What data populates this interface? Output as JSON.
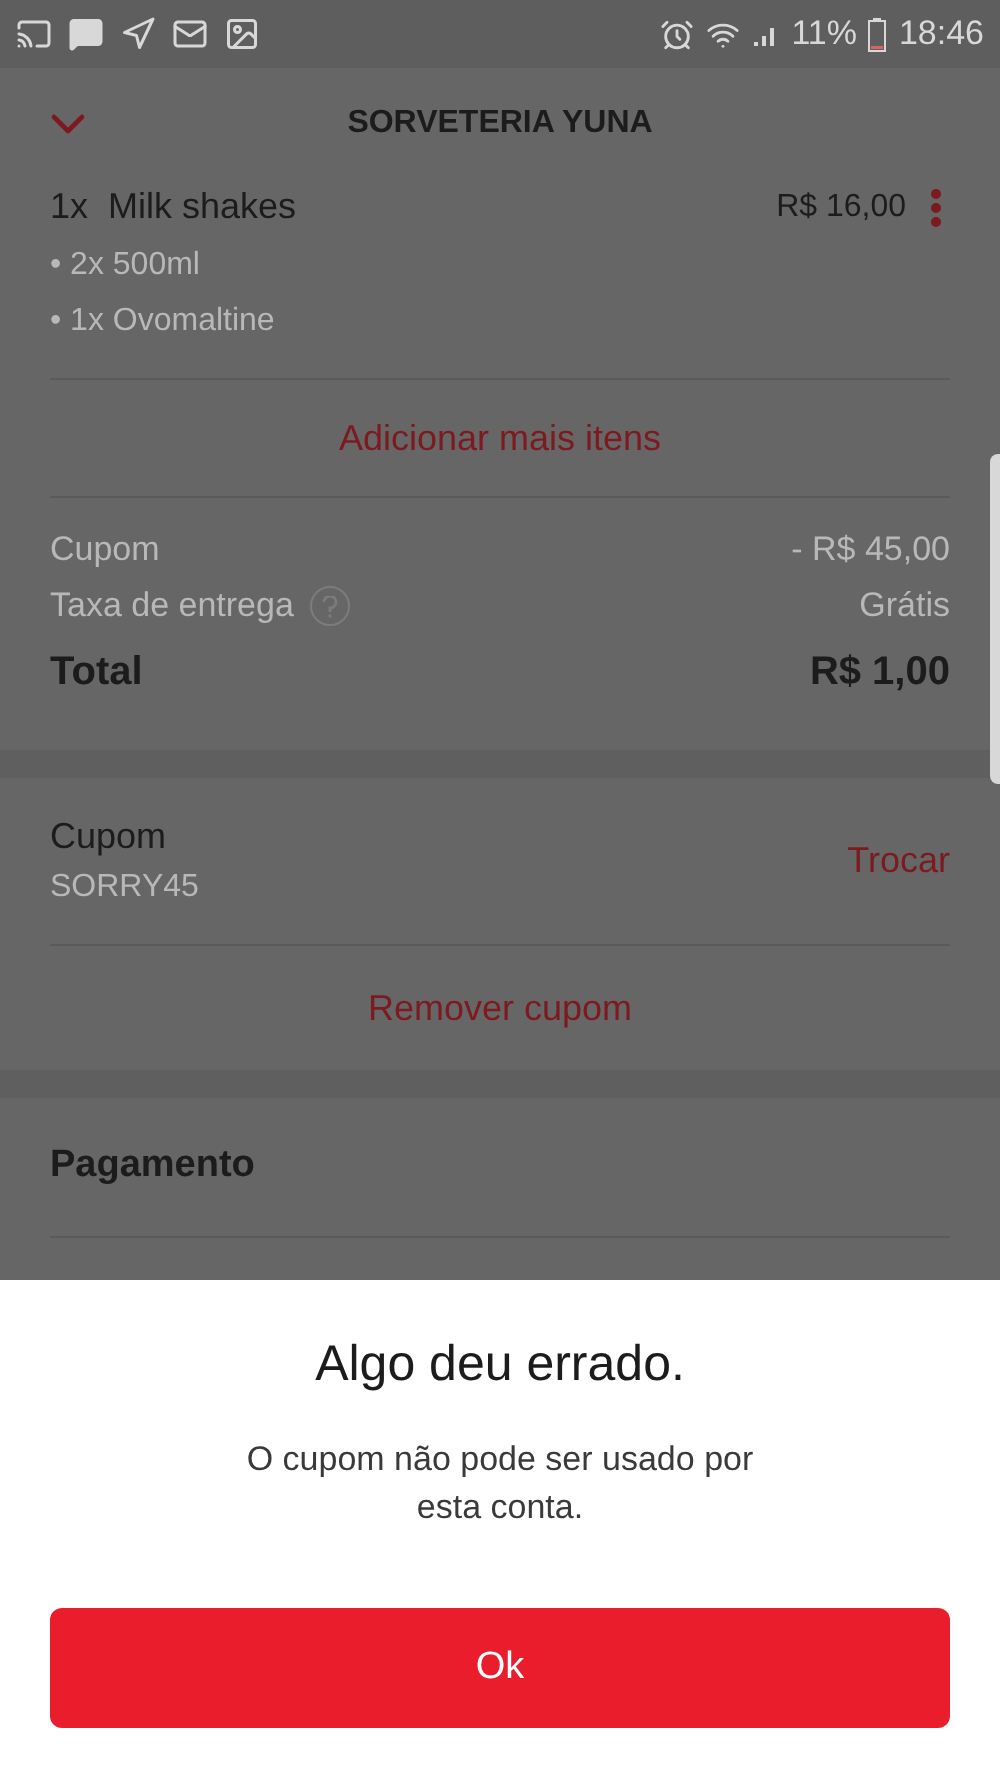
{
  "status_bar": {
    "battery": "11%",
    "time": "18:46"
  },
  "header": {
    "title": "SORVETERIA YUNA"
  },
  "order_item": {
    "quantity": "1x",
    "name": "Milk shakes",
    "price": "R$ 16,00",
    "options": [
      "• 2x 500ml",
      "• 1x Ovomaltine"
    ]
  },
  "add_more": "Adicionar mais itens",
  "summary": {
    "rows": [
      {
        "label": "Cupom",
        "value": "- R$ 45,00",
        "help": false
      },
      {
        "label": "Taxa de entrega",
        "value": "Grátis",
        "help": true
      }
    ],
    "total_label": "Total",
    "total_value": "R$ 1,00"
  },
  "coupon": {
    "title": "Cupom",
    "code": "SORRY45",
    "change": "Trocar",
    "remove": "Remover cupom"
  },
  "payment": {
    "title": "Pagamento"
  },
  "dialog": {
    "title": "Algo deu errado.",
    "message": "O cupom não pode ser usado por esta conta.",
    "button": "Ok"
  }
}
